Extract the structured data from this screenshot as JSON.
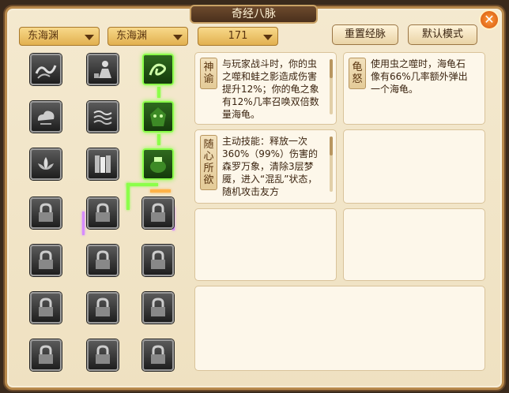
{
  "window": {
    "title": "奇经八脉",
    "close_label": "✕"
  },
  "toolbar": {
    "dropdown1": "东海渊",
    "dropdown2": "东海渊",
    "dropdown3": "171",
    "reset_label": "重置经脉",
    "default_label": "默认模式"
  },
  "colors": {
    "active_green": "#8cff4a",
    "locked_gray": "#9a9a9a",
    "accent_orange": "#ffb347"
  },
  "skills": {
    "shenyu": {
      "tag": "神谕",
      "text": "与玩家战斗时，你的虫之噬和蛙之影造成伤害提升12%；你的龟之象有12%几率召唤双倍数量海龟。"
    },
    "guinu": {
      "tag": "龟怒",
      "text": "使用虫之噬时，海龟石像有66%几率额外弹出一个海龟。"
    },
    "suixin": {
      "tag": "随心所欲",
      "text": "主动技能：释放一次360%（99%）伤害的森罗万象，清除3层梦魇，进入“混乱”状态，随机攻击友方"
    }
  },
  "grid": {
    "row0": [
      "wave-icon",
      "figure-icon",
      "swirl-icon"
    ],
    "row1": [
      "cloud-icon",
      "ripple-icon",
      "mask-icon"
    ],
    "row2": [
      "lotus-icon",
      "waterfall-icon",
      "pot-icon"
    ],
    "locked": "lock-icon"
  }
}
